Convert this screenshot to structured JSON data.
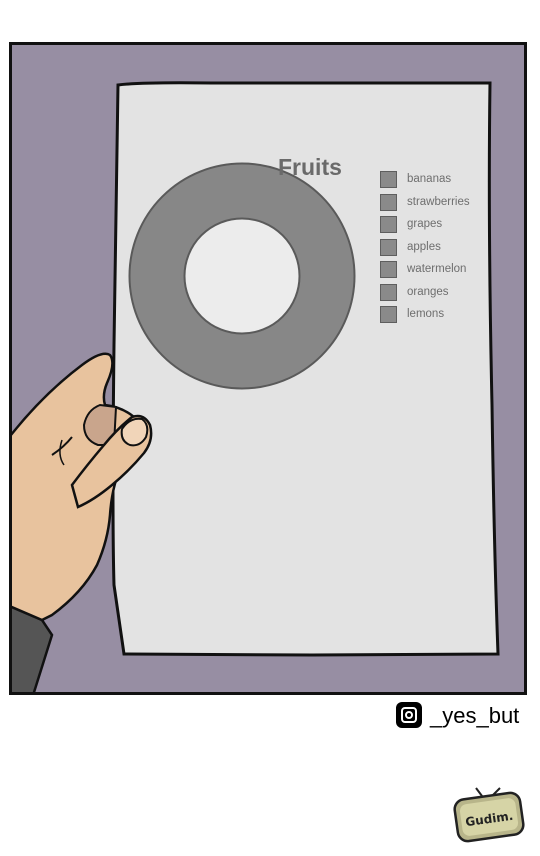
{
  "paper": {
    "title": "Fruits",
    "chart_type": "donut",
    "legend": [
      {
        "label": "bananas"
      },
      {
        "label": "strawberries"
      },
      {
        "label": "grapes"
      },
      {
        "label": "apples"
      },
      {
        "label": "watermelon"
      },
      {
        "label": "oranges"
      },
      {
        "label": "lemons"
      }
    ]
  },
  "credit": {
    "icon": "instagram-icon",
    "handle": "_yes_but"
  },
  "badge": {
    "text": "Gudim."
  },
  "colors": {
    "background_wall": "#978ea3",
    "paper": "#e3e3e3",
    "donut": "#878787",
    "skin": "#e8c39e",
    "sleeve": "#555555"
  }
}
